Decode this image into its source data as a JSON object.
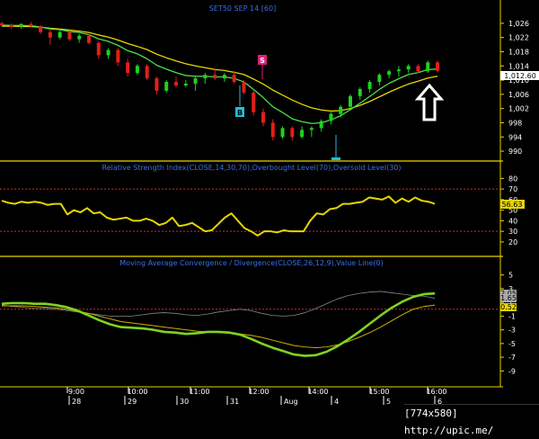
{
  "title": "SET50 SEP 14  [60]",
  "price_panel": {
    "y_ticks": [
      "1,026",
      "1,022",
      "1,018",
      "1,014",
      "1,010",
      "1,006",
      "1,002",
      "998",
      "994",
      "990"
    ],
    "y_range": [
      989,
      1028
    ],
    "last_price_label": "1,012.60",
    "markers": [
      {
        "label": "B",
        "color": "#20c0d8"
      },
      {
        "label": "S",
        "color": "#e0207a"
      }
    ]
  },
  "rsi_panel": {
    "title": "Relative Strength Index(CLOSE,14,30,70),Overbought Level(70),Oversold Level(30)",
    "y_ticks": [
      "80",
      "70",
      "60",
      "50",
      "40",
      "30",
      "20"
    ],
    "y_range": [
      14,
      82
    ],
    "levels": [
      70,
      30
    ],
    "last_value_label": "56.63"
  },
  "macd_panel": {
    "title": "Moving Average Convergence / Divergence(CLOSE,26,12,9),Value Line(0)",
    "y_ticks": [
      "5",
      "3",
      "1",
      "-1",
      "-3",
      "-5",
      "-7",
      "-9"
    ],
    "y_range": [
      -10,
      6
    ],
    "zero_line": 0,
    "value_labels": [
      "1.65",
      "0.52"
    ],
    "hidden_label": "2.05"
  },
  "x_axis": {
    "time_labels": [
      "9:00",
      "10:00",
      "11:00",
      "12:00",
      "14:00",
      "15:00",
      "16:00"
    ],
    "date_labels": [
      "28",
      "29",
      "30",
      "31",
      "Aug",
      "4",
      "5",
      "6"
    ]
  },
  "footer_text": "[774x580] http://upic.me/",
  "colors": {
    "price_ma": "#e6d500",
    "green_ma": "#4ce04c",
    "candle_up": "#20d020",
    "candle_down": "#e0201a",
    "rsi_line": "#e6d500",
    "macd_main": "#7ed321",
    "macd_signal": "#d0b000",
    "macd_hist": "#888888",
    "price_box": "#ffffff",
    "rsi_box": "#e6d500",
    "macd_box1": "#aaaaaa",
    "macd_box2": "#e6d500"
  },
  "chart_data": {
    "type": "candlestick",
    "title": "SET50 SEP 14  [60]",
    "price": {
      "ohlc": [
        [
          1026,
          1026.5,
          1025,
          1025.5
        ],
        [
          1025.5,
          1026,
          1024.5,
          1025
        ],
        [
          1025,
          1026,
          1024.5,
          1025.8
        ],
        [
          1025.8,
          1026.4,
          1025,
          1025.2
        ],
        [
          1025.2,
          1025.5,
          1023,
          1023.5
        ],
        [
          1023.5,
          1024.5,
          1020,
          1022
        ],
        [
          1022,
          1024,
          1021.5,
          1023.5
        ],
        [
          1023.5,
          1024,
          1021,
          1021.5
        ],
        [
          1021.5,
          1023,
          1020.5,
          1022.5
        ],
        [
          1022.5,
          1023,
          1020,
          1020.5
        ],
        [
          1020.5,
          1021,
          1016,
          1017
        ],
        [
          1017,
          1019,
          1016,
          1018.5
        ],
        [
          1018.5,
          1019,
          1014,
          1015
        ],
        [
          1015,
          1016,
          1011,
          1012
        ],
        [
          1012,
          1014.5,
          1011.5,
          1014
        ],
        [
          1014,
          1014.5,
          1010,
          1010.5
        ],
        [
          1010.5,
          1011,
          1006,
          1007
        ],
        [
          1007,
          1010,
          1006.5,
          1009.5
        ],
        [
          1009.5,
          1011,
          1008,
          1008.5
        ],
        [
          1008.5,
          1010,
          1008,
          1009
        ],
        [
          1009,
          1011,
          1007,
          1010.5
        ],
        [
          1010.5,
          1012,
          1009,
          1011.5
        ],
        [
          1011.5,
          1013,
          1010,
          1010.5
        ],
        [
          1010.5,
          1012,
          1009.5,
          1011.5
        ],
        [
          1011.5,
          1012.5,
          1009,
          1009.5
        ],
        [
          1009.5,
          1010,
          1006,
          1006.5
        ],
        [
          1006.5,
          1007,
          1000,
          1001
        ],
        [
          1001,
          1002,
          997,
          998
        ],
        [
          998,
          999,
          993,
          994
        ],
        [
          994,
          997,
          993.5,
          996.5
        ],
        [
          996.5,
          997,
          993,
          994
        ],
        [
          994,
          997,
          993.5,
          996
        ],
        [
          996,
          997,
          994,
          996.5
        ],
        [
          996.5,
          999,
          995.5,
          998.5
        ],
        [
          998.5,
          1001,
          997.5,
          1000.5
        ],
        [
          1000.5,
          1003,
          999.5,
          1002.5
        ],
        [
          1002.5,
          1006,
          1002,
          1005.5
        ],
        [
          1005.5,
          1008,
          1004.5,
          1007.5
        ],
        [
          1007.5,
          1010,
          1006.5,
          1009.5
        ],
        [
          1009.5,
          1012,
          1008.5,
          1011.5
        ],
        [
          1011.5,
          1013,
          1010.5,
          1012.5
        ],
        [
          1012.5,
          1014,
          1011,
          1013
        ],
        [
          1013,
          1014.5,
          1012,
          1014
        ],
        [
          1014,
          1014.5,
          1012,
          1012.5
        ],
        [
          1012.5,
          1015.5,
          1012,
          1015
        ],
        [
          1015,
          1015.5,
          1012.2,
          1012.6
        ]
      ],
      "ma_fast": [
        1025.5,
        1025.4,
        1025.4,
        1025.3,
        1025,
        1024.4,
        1024.2,
        1023.7,
        1023.4,
        1022.8,
        1021.6,
        1020.9,
        1019.8,
        1018.3,
        1017.4,
        1016,
        1014.2,
        1013.1,
        1012.1,
        1011.3,
        1011.1,
        1011.1,
        1010.9,
        1010.9,
        1010.5,
        1009.5,
        1007.4,
        1005.1,
        1002.5,
        1000.9,
        999.1,
        998.3,
        997.8,
        998,
        998.8,
        1000,
        1001.7,
        1003.5,
        1005.4,
        1007.4,
        1009.1,
        1010.4,
        1011.6,
        1012.1,
        1013,
        1013.1
      ],
      "ma_slow": [
        1025.2,
        1025.2,
        1025.1,
        1025.1,
        1024.9,
        1024.6,
        1024.4,
        1024.1,
        1023.8,
        1023.4,
        1022.7,
        1022.1,
        1021.3,
        1020.3,
        1019.5,
        1018.6,
        1017.3,
        1016.3,
        1015.4,
        1014.6,
        1014,
        1013.5,
        1013,
        1012.7,
        1012.2,
        1011.6,
        1010.3,
        1008.9,
        1007.2,
        1005.8,
        1004.4,
        1003.2,
        1002.2,
        1001.6,
        1001.3,
        1001.4,
        1002,
        1002.9,
        1004,
        1005.3,
        1006.6,
        1007.8,
        1008.9,
        1009.7,
        1010.6,
        1011.1
      ]
    },
    "rsi": [
      59,
      57,
      56,
      58,
      57,
      58,
      57,
      55,
      56,
      56,
      46,
      50,
      48,
      52,
      47,
      48,
      43,
      41,
      42,
      43,
      40,
      40,
      42,
      40,
      36,
      38,
      43,
      35,
      36,
      38,
      34,
      30,
      31,
      37,
      43,
      47,
      40,
      33,
      30,
      26,
      30,
      30,
      29,
      31,
      30,
      30,
      30,
      40,
      47,
      46,
      51,
      52,
      56,
      56,
      57,
      58,
      62,
      61,
      60,
      63,
      57,
      61,
      58,
      62,
      59,
      58,
      56
    ],
    "macd_main": [
      0.8,
      0.9,
      0.9,
      0.8,
      0.8,
      0.6,
      0.3,
      -0.2,
      -0.9,
      -1.6,
      -2.2,
      -2.6,
      -2.7,
      -2.8,
      -3.0,
      -3.3,
      -3.4,
      -3.6,
      -3.5,
      -3.3,
      -3.3,
      -3.4,
      -3.7,
      -4.3,
      -5.0,
      -5.6,
      -6.1,
      -6.6,
      -6.8,
      -6.7,
      -6.2,
      -5.4,
      -4.4,
      -3.3,
      -2.1,
      -0.9,
      0.2,
      1.1,
      1.8,
      2.2,
      2.3
    ],
    "macd_signal": [
      0.5,
      0.5,
      0.5,
      0.4,
      0.3,
      0.2,
      0.0,
      -0.3,
      -0.6,
      -1.0,
      -1.4,
      -1.8,
      -2.0,
      -2.2,
      -2.4,
      -2.6,
      -2.8,
      -3.0,
      -3.2,
      -3.3,
      -3.4,
      -3.5,
      -3.6,
      -3.8,
      -4.1,
      -4.5,
      -4.9,
      -5.3,
      -5.5,
      -5.6,
      -5.5,
      -5.2,
      -4.7,
      -4.1,
      -3.4,
      -2.6,
      -1.7,
      -0.8,
      0.0,
      0.4,
      0.6
    ],
    "macd_hist": [
      0.6,
      0.4,
      0.3,
      0.1,
      0.1,
      0.0,
      -0.2,
      -0.4,
      -0.6,
      -0.8,
      -1.0,
      -1.0,
      -1.0,
      -0.8,
      -0.6,
      -0.5,
      -0.6,
      -0.8,
      -0.9,
      -0.7,
      -0.4,
      -0.2,
      0.0,
      -0.2,
      -0.6,
      -0.9,
      -1.0,
      -0.9,
      -0.5,
      0.1,
      0.8,
      1.5,
      2.0,
      2.3,
      2.5,
      2.6,
      2.4,
      2.2,
      2.0,
      1.9,
      1.6
    ]
  }
}
